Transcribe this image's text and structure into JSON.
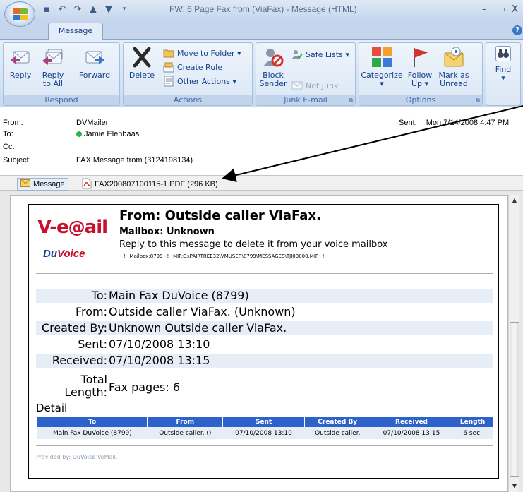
{
  "window": {
    "title": "FW: 6 Page Fax from  (ViaFax) - Message (HTML)",
    "minimize": "–",
    "maximize": "▭",
    "close": "X"
  },
  "ribbon": {
    "tab": "Message",
    "groups": {
      "respond": {
        "label": "Respond",
        "reply": "Reply",
        "reply_all": "Reply\nto All",
        "reply_all_1": "Reply",
        "reply_all_2": "to All",
        "forward": "Forward"
      },
      "actions": {
        "label": "Actions",
        "delete": "Delete",
        "move_to_folder": "Move to Folder ▾",
        "create_rule": "Create Rule",
        "other_actions": "Other Actions ▾"
      },
      "junk": {
        "label": "Junk E-mail",
        "block_1": "Block",
        "block_2": "Sender",
        "safe_lists": "Safe Lists ▾",
        "not_junk": "Not Junk"
      },
      "options": {
        "label": "Options",
        "categorize": "Categorize",
        "categorize_arrow": "▾",
        "follow_1": "Follow",
        "follow_2": "Up ▾",
        "mark_1": "Mark as",
        "mark_2": "Unread"
      },
      "find": {
        "label": "Find",
        "arrow": "▾"
      }
    }
  },
  "header": {
    "from_label": "From:",
    "from_value": "DVMailer",
    "to_label": "To:",
    "to_value": "Jamie Elenbaas",
    "cc_label": "Cc:",
    "subject_label": "Subject:",
    "subject_value": "FAX Message from  (3124198134)",
    "sent_label": "Sent:",
    "sent_value": "Mon 7/14/2008 4:47 PM"
  },
  "attachments": {
    "message_tab": "Message",
    "pdf": "FAX200807100115-1.PDF (296 KB)"
  },
  "fax": {
    "logo_text": "V-email",
    "logo_brand_du": "Du",
    "logo_brand_voice": "Voice",
    "from_line": "From: Outside caller ViaFax.",
    "mailbox": "Mailbox: Unknown",
    "reply_note": "Reply to this message to delete it from your voice mailbox",
    "path": "~!~Mailbox:8799~!~MIF:C:\\PAIRTREE32\\VMUSER\\8799\\MESSAGES\\TJJ00000.MIF~!~",
    "fields": [
      {
        "k": "To:",
        "v": "Main Fax DuVoice (8799)"
      },
      {
        "k": "From:",
        "v": "Outside caller ViaFax. (Unknown)"
      },
      {
        "k": "Created By:",
        "v": "Unknown Outside caller ViaFax."
      },
      {
        "k": "Sent:",
        "v": "07/10/2008 13:10"
      },
      {
        "k": "Received:",
        "v": "07/10/2008 13:15"
      }
    ],
    "total_1": "Total",
    "total_2": "Length:",
    "total_value": "Fax pages: 6",
    "detail_label": "Detail",
    "table": {
      "headers": [
        "To",
        "From",
        "Sent",
        "Created By",
        "Received",
        "Length"
      ],
      "rows": [
        [
          "Main Fax DuVoice (8799)",
          "Outside caller. ()",
          "07/10/2008 13:10",
          "Outside caller.",
          "07/10/2008 13:15",
          "6 sec."
        ]
      ]
    },
    "provided_prefix": "Provided by: ",
    "provided_link": "DuVoice",
    "provided_suffix": " VeMail."
  },
  "colors": {
    "ribbon_text": "#15428b",
    "table_header": "#2c62c9",
    "row_shade": "#e7edf7",
    "logo_red": "#c8102e",
    "logo_blue": "#1a3d8f"
  }
}
